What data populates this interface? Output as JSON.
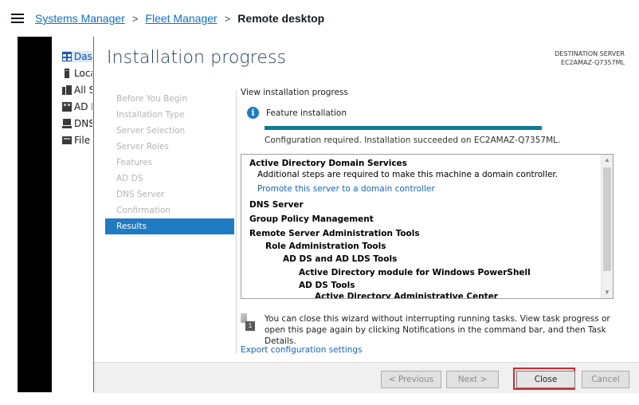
{
  "breadcrumb": {
    "items": [
      "Systems Manager",
      "Fleet Manager"
    ],
    "current": "Remote desktop"
  },
  "background_nav": [
    {
      "label": "Dashboard",
      "icon": "dashboard-icon"
    },
    {
      "label": "Local Server",
      "icon": "server-icon"
    },
    {
      "label": "All Servers",
      "icon": "servers-icon"
    },
    {
      "label": "AD DS",
      "icon": "ad-icon"
    },
    {
      "label": "DNS",
      "icon": "dns-icon"
    },
    {
      "label": "File and Storage Services",
      "icon": "file-icon"
    }
  ],
  "wizard": {
    "title": "Installation progress",
    "destination_label": "DESTINATION SERVER",
    "destination_server": "EC2AMAZ-Q7357ML",
    "steps": [
      "Before You Begin",
      "Installation Type",
      "Server Selection",
      "Server Roles",
      "Features",
      "AD DS",
      "DNS Server",
      "Confirmation",
      "Results"
    ],
    "active_step": "Results",
    "view_label": "View installation progress",
    "feature_label": "Feature installation",
    "progress_fraction": 1.0,
    "progress_message": "Configuration required. Installation succeeded on EC2AMAZ-Q7357ML.",
    "results": [
      {
        "text": "Active Directory Domain Services",
        "bold": true,
        "indent": 0
      },
      {
        "text": "Additional steps are required to make this machine a domain controller.",
        "bold": false,
        "indent": 1
      },
      {
        "text": "Promote this server to a domain controller",
        "link": true,
        "indent": 1
      },
      {
        "text": "DNS Server",
        "bold": true,
        "indent": 0
      },
      {
        "text": "Group Policy Management",
        "bold": true,
        "indent": 0
      },
      {
        "text": "Remote Server Administration Tools",
        "bold": true,
        "indent": 0
      },
      {
        "text": "Role Administration Tools",
        "bold": true,
        "indent": 1
      },
      {
        "text": "AD DS and AD LDS Tools",
        "bold": true,
        "indent": 2
      },
      {
        "text": "Active Directory module for Windows PowerShell",
        "bold": true,
        "indent": 3
      },
      {
        "text": "AD DS Tools",
        "bold": true,
        "indent": 3
      },
      {
        "text": "Active Directory Administrative Center",
        "bold": true,
        "indent": 4
      }
    ],
    "note": "You can close this wizard without interrupting running tasks. View task progress or open this page again by clicking Notifications in the command bar, and then Task Details.",
    "note_badge": "1",
    "export_link": "Export configuration settings",
    "buttons": {
      "previous": "< Previous",
      "next": "Next >",
      "close": "Close",
      "cancel": "Cancel"
    }
  }
}
